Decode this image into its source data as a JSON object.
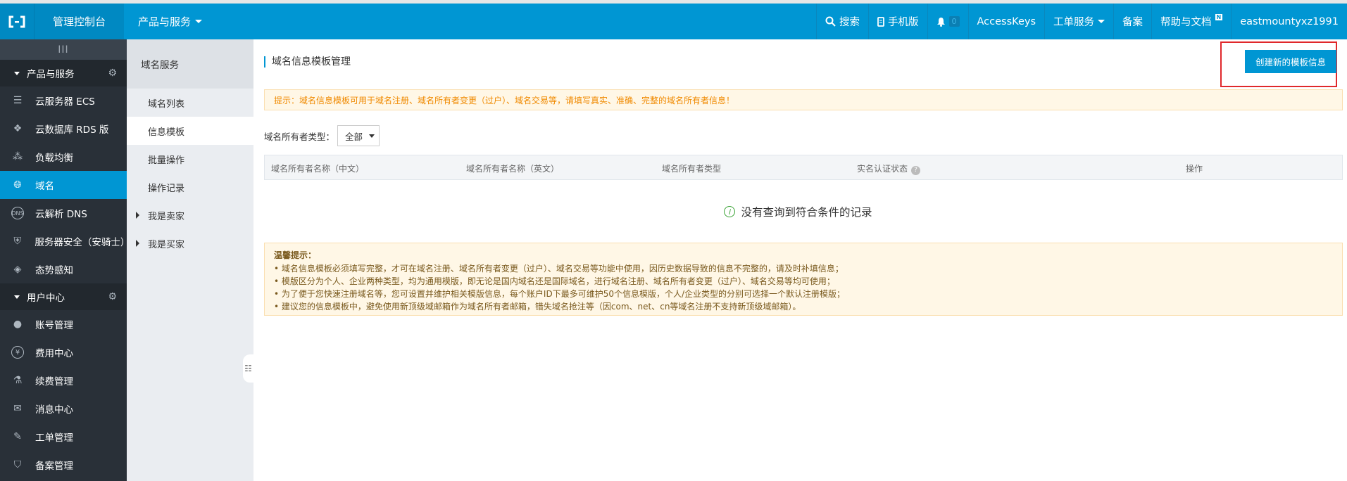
{
  "topbar": {
    "console": "管理控制台",
    "products": "产品与服务",
    "search": "搜索",
    "mobile": "手机版",
    "notify_count": "0",
    "accesskeys": "AccessKeys",
    "tickets": "工单服务",
    "beian": "备案",
    "help": "帮助与文档",
    "help_badge": "N",
    "user": "eastmountyxz1991"
  },
  "sidebar": {
    "collapse": "III",
    "group1": "产品与服务",
    "items1": [
      {
        "label": "云服务器 ECS",
        "icon": "server-icon"
      },
      {
        "label": "云数据库 RDS 版",
        "icon": "database-icon"
      },
      {
        "label": "负载均衡",
        "icon": "loadbalancer-icon"
      },
      {
        "label": "域名",
        "icon": "globe-icon"
      },
      {
        "label": "云解析 DNS",
        "icon": "dns-icon"
      },
      {
        "label": "服务器安全（安骑士）",
        "icon": "shield-icon"
      },
      {
        "label": "态势感知",
        "icon": "situation-icon"
      }
    ],
    "group2": "用户中心",
    "items2": [
      {
        "label": "账号管理",
        "icon": "user-icon"
      },
      {
        "label": "费用中心",
        "icon": "yen-icon"
      },
      {
        "label": "续费管理",
        "icon": "renew-icon"
      },
      {
        "label": "消息中心",
        "icon": "mail-icon"
      },
      {
        "label": "工单管理",
        "icon": "pencil-icon"
      },
      {
        "label": "备案管理",
        "icon": "beian-icon"
      }
    ]
  },
  "subnav": {
    "title": "域名服务",
    "items": [
      "域名列表",
      "信息模板",
      "批量操作",
      "操作记录",
      "我是卖家",
      "我是买家"
    ]
  },
  "main": {
    "title": "域名信息模板管理",
    "create_button": "创建新的模板信息",
    "tip": "提示：域名信息模板可用于域名注册、域名所有者变更（过户）、域名交易等，请填写真实、准确、完整的域名所有者信息！",
    "filter_label": "域名所有者类型：",
    "filter_value": "全部",
    "columns": [
      "域名所有者名称（中文）",
      "域名所有者名称（英文）",
      "域名所有者类型",
      "实名认证状态",
      "操作"
    ],
    "empty": "没有查询到符合条件的记录",
    "notice_title": "温馨提示：",
    "notice_items": [
      "域名信息模板必须填写完整，才可在域名注册、域名所有者变更（过户）、域名交易等功能中使用，因历史数据导致的信息不完整的，请及时补填信息；",
      "模版区分为个人、企业两种类型，均为通用模版，即无论是国内域名还是国际域名，进行域名注册、域名所有者变更（过户）、域名交易等均可使用；",
      "为了便于您快速注册域名等，您可设置并维护相关模版信息，每个账户ID下最多可维护50个信息模版，个人/企业类型的分别可选择一个默认注册模版；",
      "建议您的信息模板中，避免使用新顶级域邮箱作为域名所有者邮箱，错失域名抢注等（因com、net、cn等域名注册不支持新顶级域邮箱）。"
    ]
  }
}
